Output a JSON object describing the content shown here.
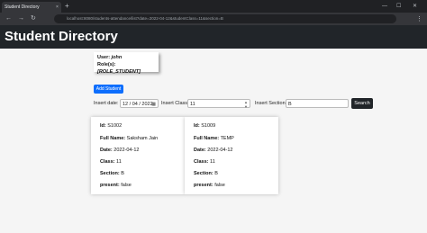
{
  "browser": {
    "tab_title": "Student Directory",
    "tab_close": "×",
    "new_tab": "+",
    "url": "localhost:8080/students-attendance/list?date=2022-04-12&studentClass=11&section=B",
    "back": "←",
    "forward": "→",
    "reload": "↻",
    "menu": "⋮",
    "minimize": "—",
    "maximize": "☐",
    "close": "✕"
  },
  "navbar": {
    "brand": "Student Directory"
  },
  "user": {
    "user_label": "User:",
    "user_value": "john",
    "role_label": "Role(s):",
    "role_value": "[ROLE_STUDENT]"
  },
  "actions": {
    "add_student": "Add Student",
    "search": "Search"
  },
  "filters": {
    "date_label": "Insert date:",
    "date_value": "12 / 04 / 2022",
    "class_label": "Insert Class:",
    "class_value": "11",
    "section_label": "Insert Section:",
    "section_value": "B"
  },
  "labels": {
    "id": "Id:",
    "full_name": "Full Name:",
    "date": "Date:",
    "class": "Class:",
    "section": "Section:",
    "present": "present:"
  },
  "students": [
    {
      "id": "S1002",
      "full_name": "Saksham Jain",
      "date": "2022-04-12",
      "class": "11",
      "section": "B",
      "present": "false"
    },
    {
      "id": "S1009",
      "full_name": "TEMP",
      "date": "2022-04-12",
      "class": "11",
      "section": "B",
      "present": "false"
    }
  ]
}
